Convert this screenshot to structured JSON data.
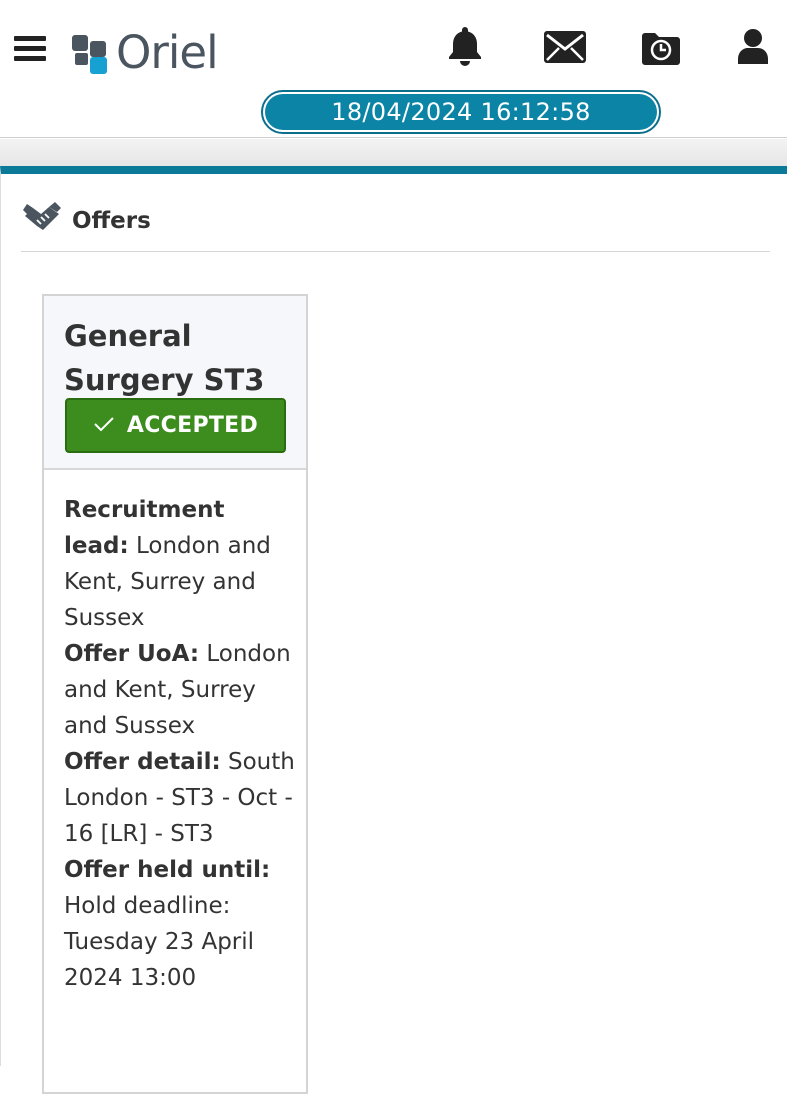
{
  "header": {
    "logo_text": "Oriel",
    "datetime": "18/04/2024 16:12:58",
    "icons": [
      "menu-icon",
      "bell-icon",
      "envelope-icon",
      "clock-folder-icon",
      "user-icon"
    ],
    "accent_color": "#0c84a6"
  },
  "panel": {
    "title": "Offers",
    "icon": "handshake-icon",
    "border_color": "#0b7a99"
  },
  "offer": {
    "title": "General Surgery ST3",
    "status": "ACCEPTED",
    "status_color": "#3c8c1e",
    "fields": {
      "recruitment_lead_label": "Recruitment lead:",
      "recruitment_lead_value": "London and Kent, Surrey and Sussex",
      "offer_uoa_label": "Offer UoA:",
      "offer_uoa_value": "London and Kent, Surrey and Sussex",
      "offer_detail_label": "Offer detail:",
      "offer_detail_value": "South London - ST3 - Oct - 16 [LR] - ST3",
      "offer_held_until_label": "Offer held until:",
      "offer_held_until_value": "Hold deadline: Tuesday 23 April 2024 13:00"
    }
  }
}
